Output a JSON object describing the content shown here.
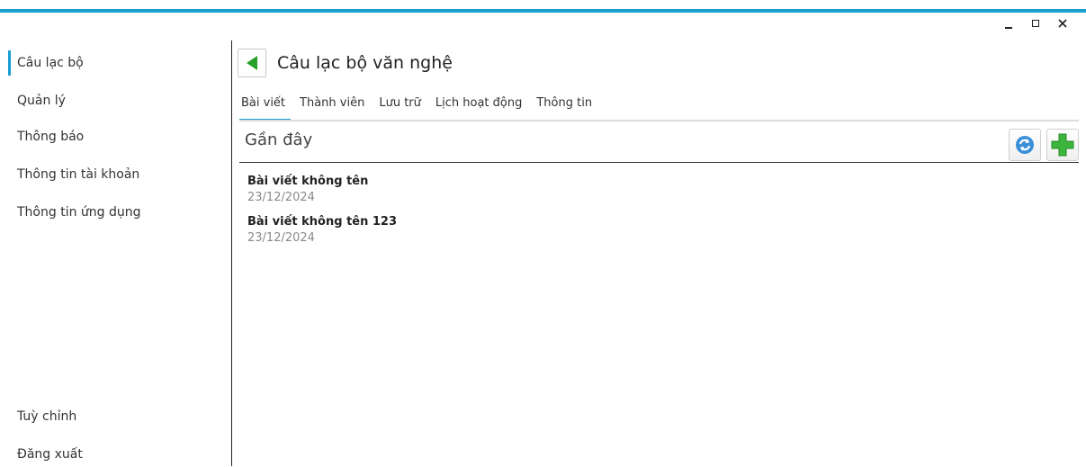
{
  "window": {
    "controls": [
      "minimize-icon",
      "maximize-icon",
      "close-icon"
    ],
    "accent_color": "#1b9dd2"
  },
  "sidebar": {
    "items": [
      {
        "label": "Câu lạc bộ",
        "active": true
      },
      {
        "label": "Quản lý"
      },
      {
        "label": "Thông báo"
      },
      {
        "label": "Thông tin tài khoản"
      },
      {
        "label": "Thông tin ứng dụng"
      }
    ],
    "bottom_items": [
      {
        "label": "Tuỳ chỉnh"
      },
      {
        "label": "Đăng xuất"
      }
    ]
  },
  "header": {
    "title": "Câu lạc bộ văn nghệ",
    "back_icon": "back-arrow-icon"
  },
  "tabs": [
    {
      "label": "Bài viết",
      "active": true
    },
    {
      "label": "Thành viên"
    },
    {
      "label": "Lưu trữ"
    },
    {
      "label": "Lịch hoạt động"
    },
    {
      "label": "Thông tin"
    }
  ],
  "section": {
    "title": "Gần đây",
    "actions": [
      "refresh-icon",
      "add-icon"
    ]
  },
  "posts": [
    {
      "title": "Bài viết không tên",
      "date": "23/12/2024"
    },
    {
      "title": "Bài viết không tên 123",
      "date": "23/12/2024"
    }
  ]
}
